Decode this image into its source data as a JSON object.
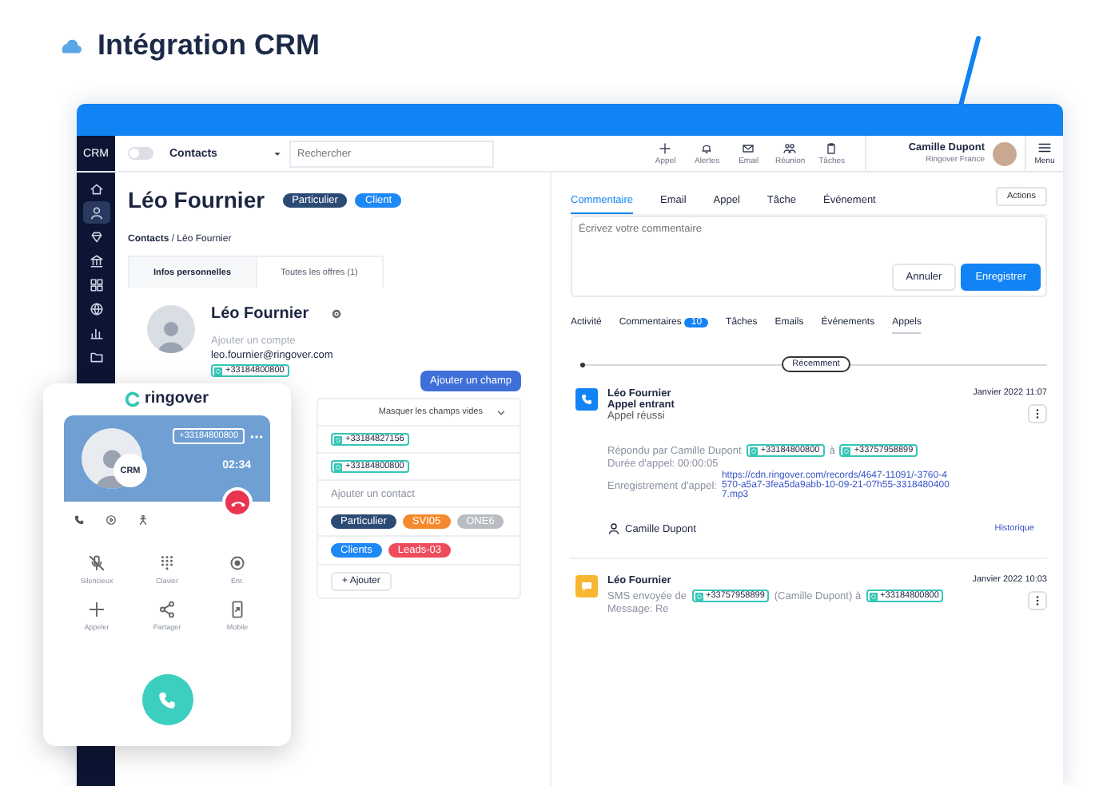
{
  "header": {
    "title": "Intégration CRM"
  },
  "crm": {
    "logo": "CRM",
    "topbar": {
      "toggle": {
        "on": false
      },
      "object_select": "Contacts",
      "search": {
        "placeholder": "Rechercher"
      },
      "actions": [
        {
          "kind": "plus",
          "label": "Appel"
        },
        {
          "kind": "bell",
          "label": "Alertes"
        },
        {
          "kind": "mail",
          "label": "Email"
        },
        {
          "kind": "people",
          "label": "Réunion"
        },
        {
          "kind": "clipboard",
          "label": "Tâches"
        }
      ],
      "user": {
        "name": "Camille Dupont",
        "team": "Ringover France"
      },
      "menu": "Menu"
    },
    "sidebar": [
      {
        "kind": "home",
        "selected": false
      },
      {
        "kind": "person",
        "selected": true
      },
      {
        "kind": "diamond",
        "selected": false
      },
      {
        "kind": "bank",
        "selected": false
      },
      {
        "kind": "grid",
        "selected": false
      },
      {
        "kind": "globe",
        "selected": false
      },
      {
        "kind": "chart",
        "selected": false
      },
      {
        "kind": "folder",
        "selected": false
      }
    ],
    "contact": {
      "name": "Léo Fournier",
      "badges": [
        {
          "label": "Particulier",
          "color": "#2b4a74"
        },
        {
          "label": "Client",
          "color": "#1e88f5"
        }
      ],
      "breadcrumb": "**Contacts** / Léo Fournier",
      "tabs": [
        {
          "label": "Infos personnelles",
          "selected": true
        },
        {
          "label": "Toutes les offres (1)",
          "selected": false
        }
      ],
      "card": {
        "name": "Léo Fournier",
        "account_prompt": "Ajouter un compte",
        "email": "leo.fournier@ringover.com",
        "phone": "+33184800800"
      },
      "add_field": "Ajouter un champ",
      "hide_empty": "Masquer les champs vides",
      "phones": [
        "+33184827156",
        "+33184800800"
      ],
      "add_contact": "Ajouter un contact",
      "tag_rows": [
        [
          {
            "label": "Particulier",
            "color": "#2b4a74"
          },
          {
            "label": "SVI05",
            "color": "#f5892b"
          },
          {
            "label": "ONE6",
            "color": "#b9bcc2"
          }
        ],
        [
          {
            "label": "Clients",
            "color": "#1e88f5"
          },
          {
            "label": "Leads-03",
            "color": "#ee4c5d"
          }
        ]
      ],
      "add_tag": "+ Ajouter"
    },
    "composer": {
      "tabs": [
        {
          "label": "Commentaire",
          "selected": true
        },
        {
          "label": "Email",
          "selected": false
        },
        {
          "label": "Appel",
          "selected": false
        },
        {
          "label": "Tâche",
          "selected": false
        },
        {
          "label": "Événement",
          "selected": false
        }
      ],
      "actions_button": "Actions",
      "placeholder": "Écrivez votre commentaire",
      "buttons": [
        "Annuler",
        "Enregistrer"
      ]
    },
    "filters": [
      {
        "label": "Activité",
        "selected": false
      },
      {
        "label": "Commentaires",
        "count": "10",
        "selected": false
      },
      {
        "label": "Tâches",
        "selected": false
      },
      {
        "label": "Emails",
        "selected": false
      },
      {
        "label": "Événements",
        "selected": false
      },
      {
        "label": "Appels",
        "selected": true
      }
    ],
    "timeline": {
      "marker": "Récemment",
      "entries": [
        {
          "kind": "call",
          "name": "Léo Fournier",
          "subtitle": "Appel entrant",
          "status": "Appel réussi",
          "date": "Janvier 2022 11:07",
          "details": [
            [
              {
                "kind": "text",
                "text": "Répondu par Camille Dupont"
              },
              {
                "kind": "chip",
                "text": "+33184800800"
              },
              {
                "kind": "text",
                "text": "à"
              },
              {
                "kind": "chip",
                "text": "+33757958899"
              }
            ],
            [
              {
                "kind": "text",
                "text": "Durée d'appel: 00:00:05"
              }
            ],
            [
              {
                "kind": "text",
                "text": "Enregistrement d'appel:"
              },
              {
                "kind": "link",
                "text": "https://cdn.ringover.com/records/4647-11091/-3760-4570-a5a7-3fea5da9abb-10-09-21-07h55-33184804007.mp3"
              }
            ]
          ],
          "agent": "Camille Dupont",
          "history": "Historique"
        },
        {
          "kind": "sms",
          "name": "Léo Fournier",
          "date": "Janvier 2022 10:03",
          "details": [
            [
              {
                "kind": "text",
                "text": "SMS envoyée de"
              },
              {
                "kind": "chip",
                "text": "+33757958899"
              },
              {
                "kind": "text",
                "text": "(Camille Dupont) à"
              },
              {
                "kind": "chip",
                "text": "+33184800800"
              }
            ],
            [
              {
                "kind": "text",
                "text": "Message: Re"
              }
            ]
          ]
        }
      ]
    }
  },
  "phone": {
    "brand": "ringover",
    "number": "+33184800800",
    "badge": "CRM",
    "timer": "02:34",
    "mini_icons": [
      {
        "kind": "phone"
      },
      {
        "kind": "play"
      },
      {
        "kind": "figure"
      }
    ],
    "controls": [
      {
        "kind": "mic-off",
        "label": "Silencieux"
      },
      {
        "kind": "keypad",
        "label": "Clavier"
      },
      {
        "kind": "record",
        "label": "Enr."
      },
      {
        "kind": "plus",
        "label": "Appeler"
      },
      {
        "kind": "share",
        "label": "Partager"
      },
      {
        "kind": "mobile",
        "label": "Mobile"
      }
    ]
  }
}
